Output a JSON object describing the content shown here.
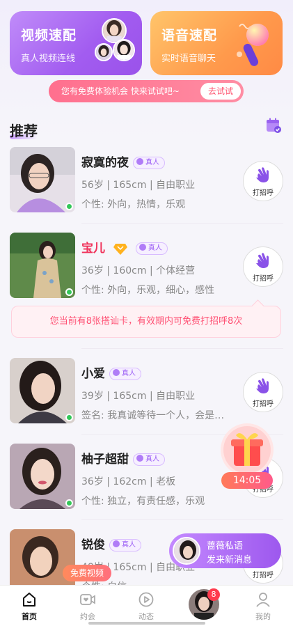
{
  "top_cards": {
    "video": {
      "title": "视频速配",
      "subtitle": "真人视频连线"
    },
    "voice": {
      "title": "语音速配",
      "subtitle": "实时语音聊天"
    }
  },
  "trial_banner": {
    "text": "您有免费体验机会 快来试试吧~",
    "button": "去试试"
  },
  "section": {
    "title": "推荐",
    "calendar_icon": "calendar-check-icon"
  },
  "greet_label": "打招呼",
  "verified_label": "真人",
  "users": [
    {
      "name": "寂寞的夜",
      "info": "56岁 | 165cm | 自由职业",
      "tags": "个性: 外向，热情，乐观",
      "verified": true,
      "vip": false,
      "online": true
    },
    {
      "name": "宝儿",
      "info": "36岁 | 160cm | 个体经营",
      "tags": "个性: 外向，乐观，细心，感性",
      "verified": true,
      "vip": true,
      "online": true
    },
    {
      "name": "小爱",
      "info": "39岁 | 165cm | 自由职业",
      "tags": "签名: 我真诚等待一个人，会是…",
      "verified": true,
      "vip": false,
      "online": true
    },
    {
      "name": "柚子超甜",
      "info": "36岁 | 162cm | 老板",
      "tags": "个性: 独立，有责任感，乐观",
      "verified": true,
      "vip": false,
      "online": true
    },
    {
      "name": "锐俊",
      "info": "48岁 | 165cm | 自由职业",
      "tags": "个性: 自信",
      "verified": true,
      "vip": false,
      "online": false
    }
  ],
  "chat_card_tip": "您当前有8张搭讪卡，有效期内可免费打招呼8次",
  "gift_timer": "14:05",
  "message_popup": {
    "line1": "蔷薇私语",
    "line2": "发来新消息"
  },
  "free_video": "免费视频",
  "tabs": [
    {
      "label": "首页",
      "icon": "home-icon",
      "active": true
    },
    {
      "label": "约会",
      "icon": "video-heart-icon",
      "active": false
    },
    {
      "label": "动态",
      "icon": "play-circle-icon",
      "active": false
    },
    {
      "label": "",
      "icon": "avatar",
      "active": false
    },
    {
      "label": "我的",
      "icon": "profile-icon",
      "active": false
    }
  ],
  "tab_badge": "8",
  "colors": {
    "accent_purple": "#a25cf0",
    "accent_orange": "#ff9a4c",
    "accent_pink": "#ff5470",
    "online": "#34c759"
  }
}
